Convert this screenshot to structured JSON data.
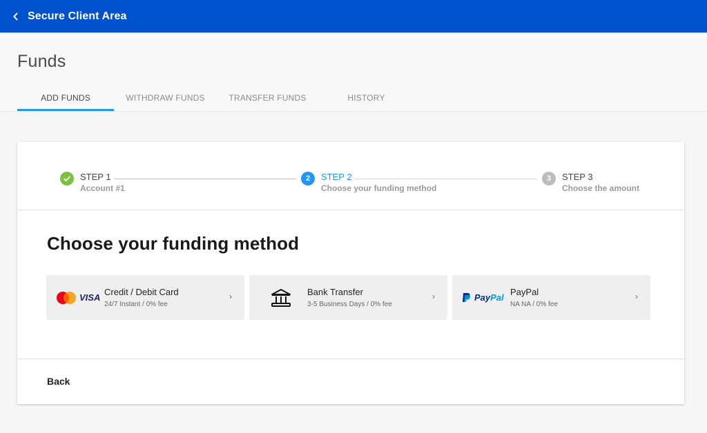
{
  "appbar": {
    "back_icon": "chevron-left-icon",
    "title": "Secure Client Area",
    "color": "#0052cc"
  },
  "page": {
    "title": "Funds"
  },
  "tabs": [
    {
      "label": "ADD FUNDS",
      "active": true
    },
    {
      "label": "WITHDRAW FUNDS",
      "active": false
    },
    {
      "label": "TRANSFER FUNDS",
      "active": false
    },
    {
      "label": "HISTORY",
      "active": false
    }
  ],
  "stepper": {
    "steps": [
      {
        "number": "1",
        "label": "STEP 1",
        "sub": "Account #1",
        "state": "completed",
        "icon": "check-icon",
        "color": "#7cc142"
      },
      {
        "number": "2",
        "label": "STEP 2",
        "sub": "Choose your funding method",
        "state": "active",
        "color": "#2196f3"
      },
      {
        "number": "3",
        "label": "STEP 3",
        "sub": "Choose the amount",
        "state": "pending",
        "color": "#bdbdbd"
      }
    ]
  },
  "main": {
    "title": "Choose your funding method",
    "methods": [
      {
        "name": "Credit / Debit Card",
        "desc": "24/7 Instant / 0% fee",
        "logo": "mastercard-visa-logo",
        "visa_text": "VISA"
      },
      {
        "name": "Bank Transfer",
        "desc": "3-5 Business Days / 0% fee",
        "logo": "bank-icon"
      },
      {
        "name": "PayPal",
        "desc": "NA NA / 0% fee",
        "logo": "paypal-logo",
        "paypal_text_1": "Pay",
        "paypal_text_2": "Pal"
      }
    ],
    "chevron": "›"
  },
  "footer": {
    "back_label": "Back"
  }
}
